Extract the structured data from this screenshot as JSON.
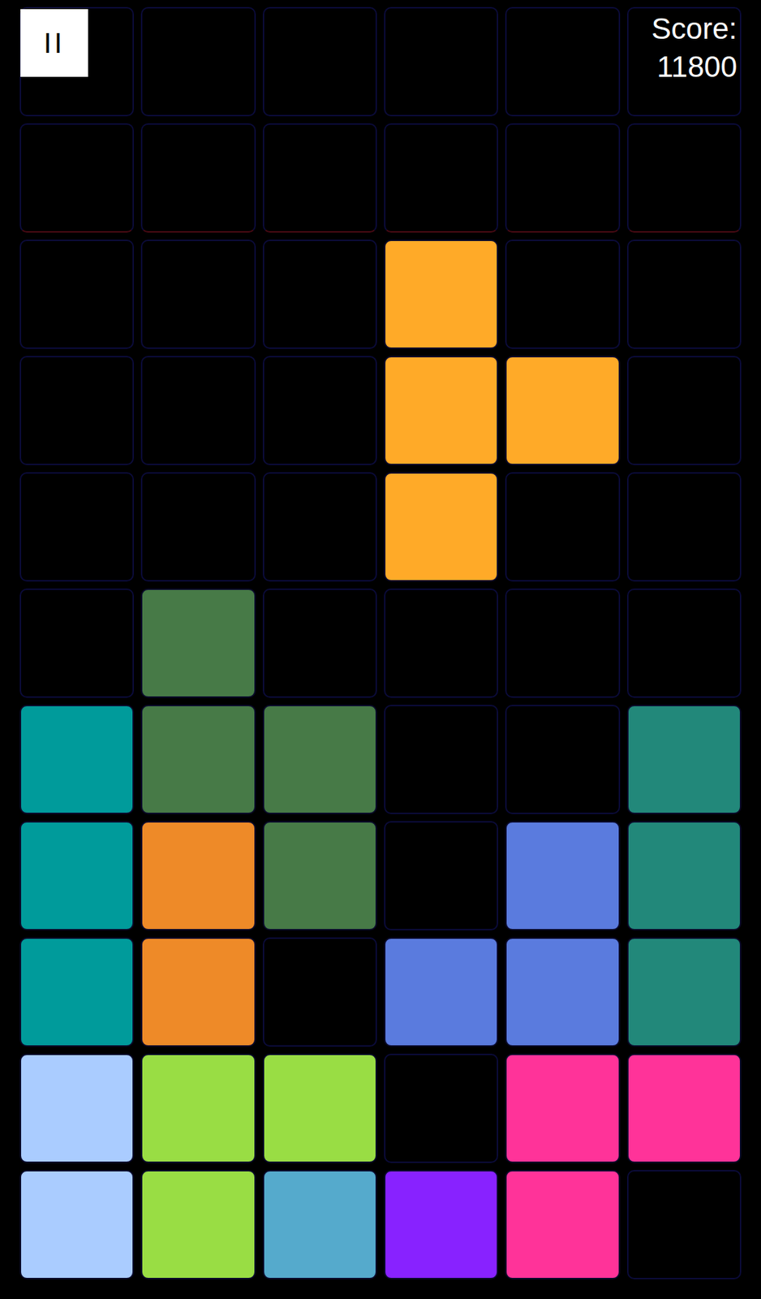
{
  "pause_button": {
    "label": "II"
  },
  "score": {
    "label": "Score:",
    "value": "11800"
  },
  "board": {
    "rows": [
      {
        "limit": false,
        "cells": [
          null,
          null,
          null,
          null,
          null,
          null
        ]
      },
      {
        "limit": true,
        "cells": [
          null,
          null,
          null,
          null,
          null,
          null
        ]
      },
      {
        "limit": false,
        "cells": [
          null,
          null,
          null,
          "#FFAA28",
          null,
          null
        ]
      },
      {
        "limit": false,
        "cells": [
          null,
          null,
          null,
          "#FFAA28",
          "#FFAA28",
          null
        ]
      },
      {
        "limit": false,
        "cells": [
          null,
          null,
          null,
          "#FFAA28",
          null,
          null
        ]
      },
      {
        "limit": false,
        "cells": [
          null,
          "#477A47",
          null,
          null,
          null,
          null
        ]
      },
      {
        "limit": false,
        "cells": [
          "#009B9B",
          "#477A47",
          "#477A47",
          null,
          null,
          "#22887A"
        ]
      },
      {
        "limit": false,
        "cells": [
          "#009B9B",
          "#EE8A28",
          "#477A47",
          null,
          "#5A7BDE",
          "#22887A"
        ]
      },
      {
        "limit": false,
        "cells": [
          "#009B9B",
          "#EE8A28",
          null,
          "#5A7BDE",
          "#5A7BDE",
          "#22887A"
        ]
      },
      {
        "limit": false,
        "cells": [
          "#AACCFF",
          "#99DD44",
          "#99DD44",
          null,
          "#FF3399",
          "#FF3399"
        ]
      },
      {
        "limit": false,
        "cells": [
          "#AACCFF",
          "#99DD44",
          "#55AACC",
          "#8822FF",
          "#FF3399",
          null
        ]
      }
    ]
  }
}
